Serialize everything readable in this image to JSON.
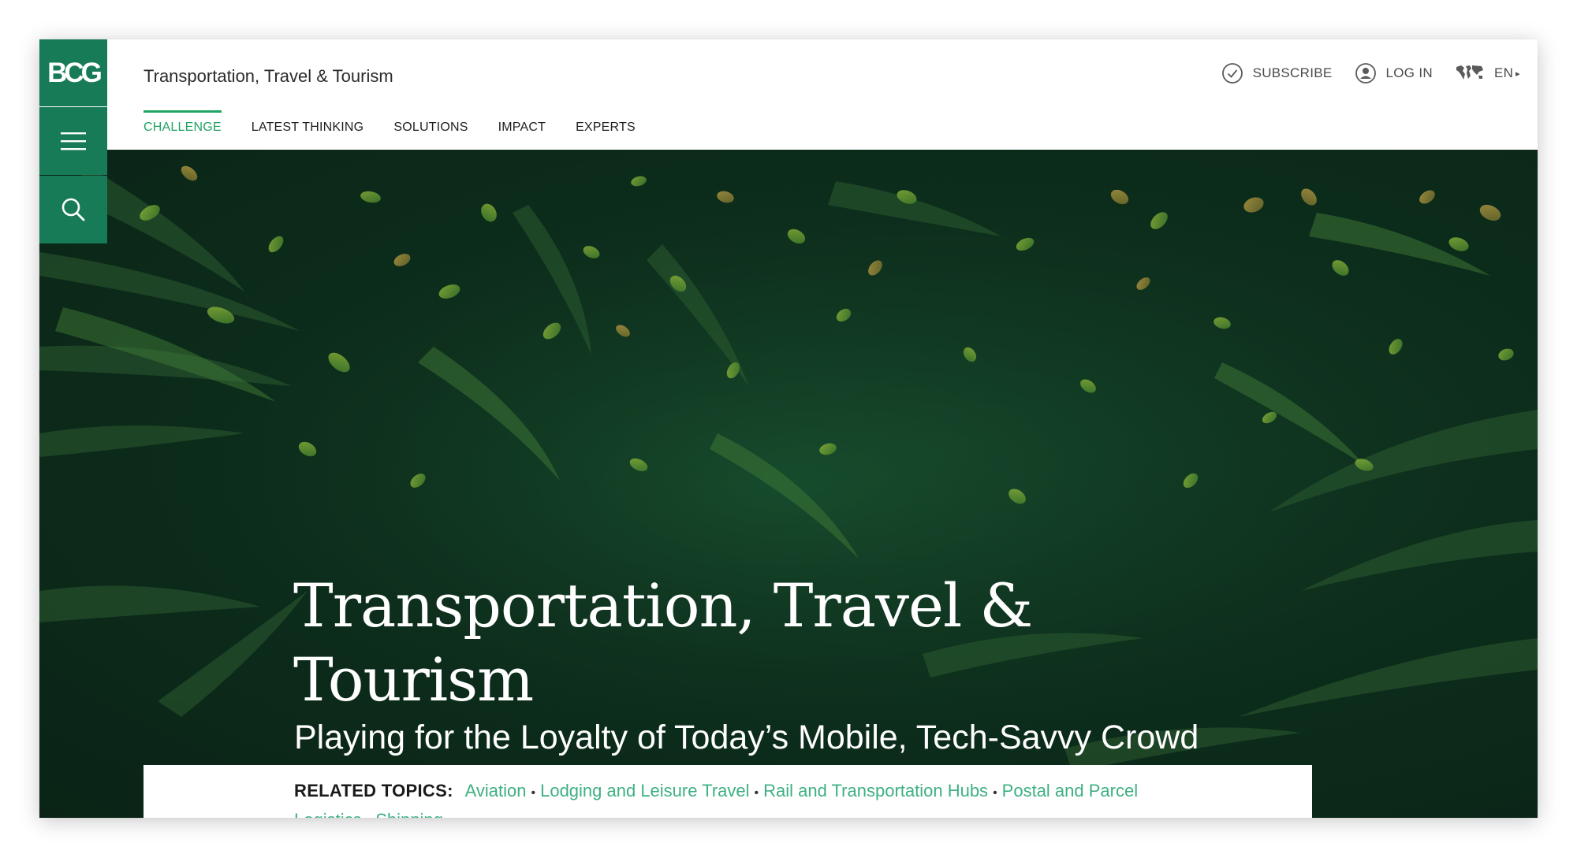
{
  "brand": {
    "logo_text": "BCG",
    "accent_color": "#177b57",
    "active_tab_color": "#21a363",
    "topic_link_color": "#3eb082"
  },
  "rail": {
    "menu_icon": "hamburger-icon",
    "search_icon": "search-icon"
  },
  "header": {
    "site_title": "Transportation, Travel & Tourism",
    "tabs": [
      {
        "label": "CHALLENGE",
        "active": true
      },
      {
        "label": "LATEST THINKING",
        "active": false
      },
      {
        "label": "SOLUTIONS",
        "active": false
      },
      {
        "label": "IMPACT",
        "active": false
      },
      {
        "label": "EXPERTS",
        "active": false
      }
    ],
    "actions": {
      "subscribe": "SUBSCRIBE",
      "login": "LOG IN",
      "language": "EN"
    }
  },
  "hero": {
    "title": "Transportation, Travel & Tourism",
    "subtitle": "Playing for the Loyalty of Today’s Mobile, Tech-Savvy Crowd"
  },
  "related": {
    "label": "RELATED TOPICS:",
    "topics": [
      "Aviation",
      "Lodging and Leisure Travel",
      "Rail and Transportation Hubs",
      "Postal and Parcel Logistics",
      "Shipping"
    ]
  }
}
